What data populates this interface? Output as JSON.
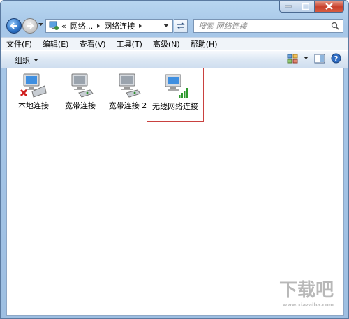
{
  "address": {
    "overflow": "«",
    "crumbs": [
      "网络...",
      "网络连接"
    ]
  },
  "search": {
    "placeholder": "搜索 网络连接"
  },
  "menu": [
    {
      "label": "文件(F)"
    },
    {
      "label": "编辑(E)"
    },
    {
      "label": "查看(V)"
    },
    {
      "label": "工具(T)"
    },
    {
      "label": "高级(N)"
    },
    {
      "label": "帮助(H)"
    }
  ],
  "toolbar": {
    "organize_label": "组织"
  },
  "connections": [
    {
      "label": "本地连接",
      "icon": "disconnected-lan-icon"
    },
    {
      "label": "宽带连接",
      "icon": "broadband-icon"
    },
    {
      "label": "宽带连接 2",
      "icon": "broadband-icon"
    },
    {
      "label": "无线网络连接",
      "icon": "wireless-icon"
    }
  ],
  "watermark": {
    "brand": "下载吧",
    "url": "www.xiazaiba.com"
  },
  "colors": {
    "selection_border": "#c9413f",
    "close_button": "#c7402c",
    "window_frame": "#a7c7e8"
  }
}
